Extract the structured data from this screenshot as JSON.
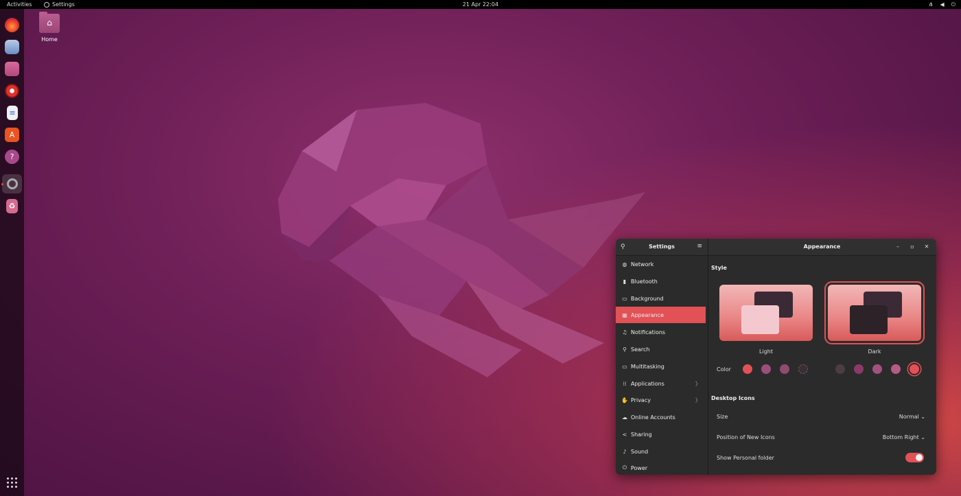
{
  "topbar": {
    "activities": "Activities",
    "app_name": "Settings",
    "clock": "21 Apr  22:04",
    "tray_icons": [
      "network-icon",
      "volume-icon",
      "power-icon"
    ]
  },
  "dock": {
    "items": [
      "firefox-icon",
      "thunderbird-icon",
      "files-icon",
      "rhythmbox-icon",
      "writer-icon",
      "app-center-icon",
      "help-icon",
      "settings-icon",
      "trash-icon"
    ],
    "apps_grid": "show-apps-icon"
  },
  "desktop": {
    "home_label": "Home"
  },
  "settings": {
    "sidebar_title": "Settings",
    "page_title": "Appearance",
    "sidebar": [
      {
        "label": "Network",
        "icon": "globe-icon"
      },
      {
        "label": "Bluetooth",
        "icon": "bluetooth-icon"
      },
      {
        "label": "Background",
        "icon": "background-icon"
      },
      {
        "label": "Appearance",
        "icon": "appearance-icon"
      },
      {
        "label": "Notifications",
        "icon": "bell-icon"
      },
      {
        "label": "Search",
        "icon": "search-icon"
      },
      {
        "label": "Multitasking",
        "icon": "multitasking-icon"
      },
      {
        "label": "Applications",
        "icon": "grid-icon"
      },
      {
        "label": "Privacy",
        "icon": "hand-icon"
      },
      {
        "label": "Online Accounts",
        "icon": "cloud-icon"
      },
      {
        "label": "Sharing",
        "icon": "share-icon"
      },
      {
        "label": "Sound",
        "icon": "music-note-icon"
      },
      {
        "label": "Power",
        "icon": "power-icon"
      }
    ],
    "selected_item": "Appearance",
    "style_heading": "Style",
    "style_options": {
      "light": "Light",
      "dark": "Dark"
    },
    "selected_style": "Dark",
    "color_label": "Color",
    "accent_colors": [
      "#e25156",
      "#9c4e7b",
      "#8f4c6f",
      "#3a2f36",
      "#4a3e44",
      "#8a3a68",
      "#a2527e",
      "#b55c85",
      "#e25156"
    ],
    "selected_color_index": 8,
    "desktop_icons_heading": "Desktop Icons",
    "size_label": "Size",
    "size_value": "Normal",
    "position_label": "Position of New Icons",
    "position_value": "Bottom Right",
    "personal_folder_label": "Show Personal folder",
    "personal_folder_on": true
  }
}
